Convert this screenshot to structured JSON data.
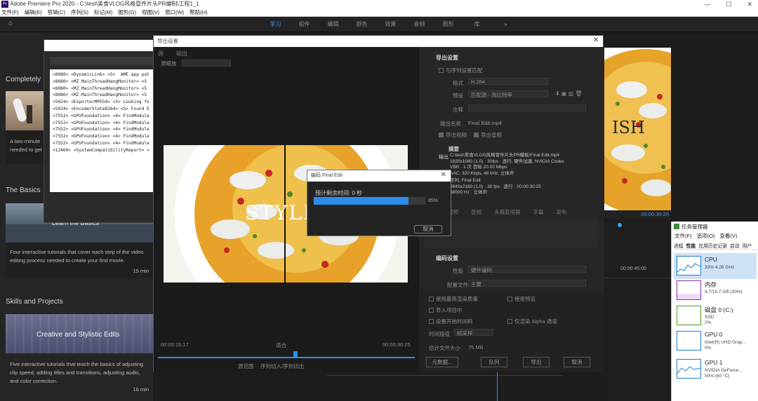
{
  "app": {
    "title": "Adobe Premiere Pro 2020 - C:\\test\\美食VLOG风格冒件片头PR编制\\工程1_1",
    "icon_label": "Pr"
  },
  "menu": [
    "文件(F)",
    "编辑(E)",
    "剪辑(C)",
    "序列(S)",
    "标记(M)",
    "图形(G)",
    "视图(V)",
    "窗口(W)",
    "帮助(H)"
  ],
  "workspaces": {
    "tabs": [
      "学习",
      "组件",
      "编辑",
      "颜色",
      "效果",
      "音频",
      "图形",
      "库",
      "»"
    ],
    "active_index": 0
  },
  "learn": {
    "header_completely": "Completely",
    "card0_text": "A two-minute\nneeded to get",
    "the_basics": "The Basics",
    "basics_card_title": "Learn the Basics",
    "basics_desc": "Four interactive tutorials that cover each step of the video editing process needed to create your first movie.",
    "basics_min": "15 min",
    "skills": "Skills and Projects",
    "skills_card_title": "Creative and Stylistic Edits",
    "skills_desc": "Five interactive tutorials that teach the basics of adjusting clip speed, adding titles and transitions, adjusting audio, and color correction.",
    "skills_min": "16 min"
  },
  "console": {
    "lines": [
      "<8080> <DynamicLink> <5>  AME app pat",
      "<8080> <MZ.MainThreadHangMonitor> <5",
      "<8080> <MZ.MainThreadHangMonitor> <5",
      "<8080> <MZ.MainThreadHangMonitor> <5",
      "<5024> <ExporterMPEG4> <5> Looking fo",
      "<5024> <EncoderState8264> <5> Found E",
      "<7552> <GPUFoundation> <4> FindModule",
      "<7552> <GPUFoundation> <4> FindModule",
      "<7552> <GPUFoundation> <4> FindModule",
      "<7552> <GPUFoundation> <4> FindModule",
      "<7552> <GPUFoundation> <4> FindModule",
      "<12460> <SystemCompatibilityReport> <"
    ]
  },
  "export": {
    "title": "导出设置",
    "source_tabs": [
      "源",
      "输出"
    ],
    "source_scale_label": "源缩放",
    "preview_text": "STYLISH",
    "timecode_left": "00:00:15:17",
    "fit_label": "适合",
    "timecode_right": "00:00:30:25",
    "source_range_label": "源范围",
    "source_range_value": "序列切入/序列切出",
    "settings_header": "导出设置",
    "match_sequence": "与序列设置匹配",
    "format_label": "格式",
    "format_value": "H.264",
    "preset_label": "预设",
    "preset_value": "匹配源 - 高比特率",
    "comment_label": "注释",
    "output_name_label": "输出名称",
    "output_name_value": "Final Edit.mp4",
    "export_video": "导出视频",
    "export_audio": "导出音频",
    "summary_label": "摘要",
    "summary_output_label": "输出",
    "summary_output": "C:\\test\\美食VLOG风格冒件片头PR模板\\Final Edit.mp4\n1920x1080 (1.0) · 30fps · 逐行, 硬件加速, NVIDIA Codec\nVBR · 1 次 目标 20.00 Mbps\nAAC, 320 Kbps, 48 kHz, 立体声",
    "summary_source_label": "源",
    "summary_source": "序列, Final Edit\n3840x2160 (1.0) · 30 fps · 逐行 · 00:00:30:25\n48000 Hz · 立体声",
    "tabs2": [
      "效果",
      "视频",
      "音频",
      "多路复用器",
      "字幕",
      "发布"
    ],
    "encode_header": "编码设置",
    "perf_label": "性能",
    "perf_value": "硬件编码",
    "profile_label": "配置文件",
    "profile_value": "主要",
    "use_max_quality": "使用最高渲染质量",
    "use_preview": "使用预览",
    "import_project": "导入项目中",
    "set_start_tc": "设置开始时间码",
    "render_alpha": "仅渲染 Alpha 通道",
    "time_interp_label": "时间插值",
    "time_interp_value": "帧采样",
    "file_size_label": "估计文件大小",
    "file_size_value": "75 MB",
    "btn_metadata": "元数据...",
    "btn_queue": "队列",
    "btn_export": "导出",
    "btn_cancel": "取消"
  },
  "progress_dialog": {
    "title": "编码 Final Edit",
    "remaining": "预计剩余时间: 0 秒",
    "percent_text": "85%",
    "percent_value": 85,
    "cancel": "取消"
  },
  "program": {
    "text": "ISH",
    "timecode": "00:00:30:25",
    "ruler_time": "00:00:45:00"
  },
  "taskmanager": {
    "title": "任务管理器",
    "menu": [
      "文件(F)",
      "选项(O)",
      "查看(V)"
    ],
    "tabs": [
      "进程",
      "性能",
      "应用历史记录",
      "启动",
      "用户"
    ],
    "items": [
      {
        "name": "CPU",
        "sub": "33% 4.26 GHz",
        "color": "#1a7fd4"
      },
      {
        "name": "内存",
        "sub": "4.7/15.7 GB (30%)",
        "color": "#8b2ab3"
      },
      {
        "name": "磁盘 0 (C:)",
        "sub": "SSD\n2%",
        "color": "#4d9a1b"
      },
      {
        "name": "GPU 0",
        "sub": "Intel(R) UHD Grap...\n0%",
        "color": "#1a7fd4"
      },
      {
        "name": "GPU 1",
        "sub": "NVIDIA GeForce...\n50% (60 °C)",
        "color": "#1a7fd4"
      }
    ]
  }
}
